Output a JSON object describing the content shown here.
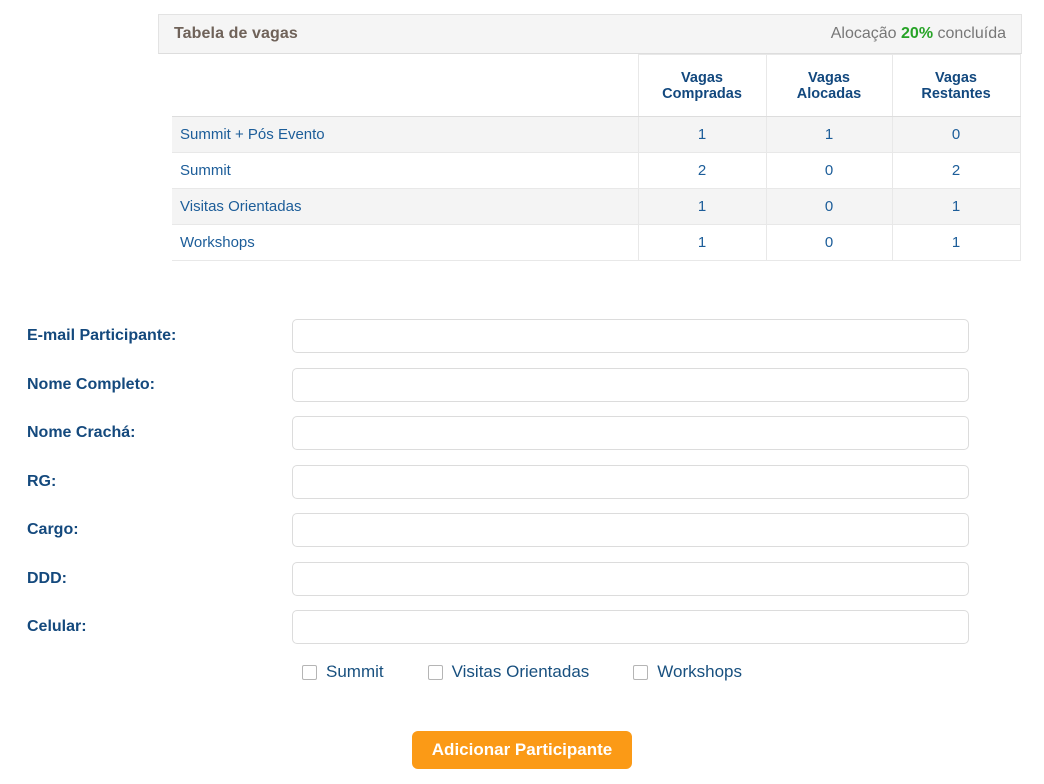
{
  "panel": {
    "title": "Tabela de vagas",
    "allocation": {
      "prefix": "Alocação",
      "percent": "20%",
      "suffix": "concluída",
      "percent_color": "#26a326"
    }
  },
  "table": {
    "columns": [
      "",
      "Vagas Compradas",
      "Vagas Alocadas",
      "Vagas Restantes"
    ],
    "col_name_header": "",
    "col_compradas_header_line1": "Vagas",
    "col_compradas_header_line2": "Compradas",
    "col_alocadas_header": "Vagas Alocadas",
    "col_restantes_header": "Vagas Restantes",
    "rows": [
      {
        "name": "Summit + Pós Evento",
        "compradas": "1",
        "alocadas": "1",
        "restantes": "0"
      },
      {
        "name": "Summit",
        "compradas": "2",
        "alocadas": "0",
        "restantes": "2"
      },
      {
        "name": "Visitas Orientadas",
        "compradas": "1",
        "alocadas": "0",
        "restantes": "1"
      },
      {
        "name": "Workshops",
        "compradas": "1",
        "alocadas": "0",
        "restantes": "1"
      }
    ]
  },
  "form": {
    "fields": [
      {
        "label": "E-mail Participante:",
        "value": "",
        "placeholder": ""
      },
      {
        "label": "Nome Completo:",
        "value": "",
        "placeholder": ""
      },
      {
        "label": "Nome Crachá:",
        "value": "",
        "placeholder": ""
      },
      {
        "label": "RG:",
        "value": "",
        "placeholder": ""
      },
      {
        "label": "Cargo:",
        "value": "",
        "placeholder": ""
      },
      {
        "label": "DDD:",
        "value": "",
        "placeholder": ""
      },
      {
        "label": "Celular:",
        "value": "",
        "placeholder": ""
      }
    ],
    "checkboxes": [
      {
        "label": "Summit",
        "checked": false
      },
      {
        "label": "Visitas Orientadas",
        "checked": false
      },
      {
        "label": "Workshops",
        "checked": false
      }
    ],
    "submit_label": "Adicionar Participante",
    "submit_color": "#fb9a16"
  }
}
